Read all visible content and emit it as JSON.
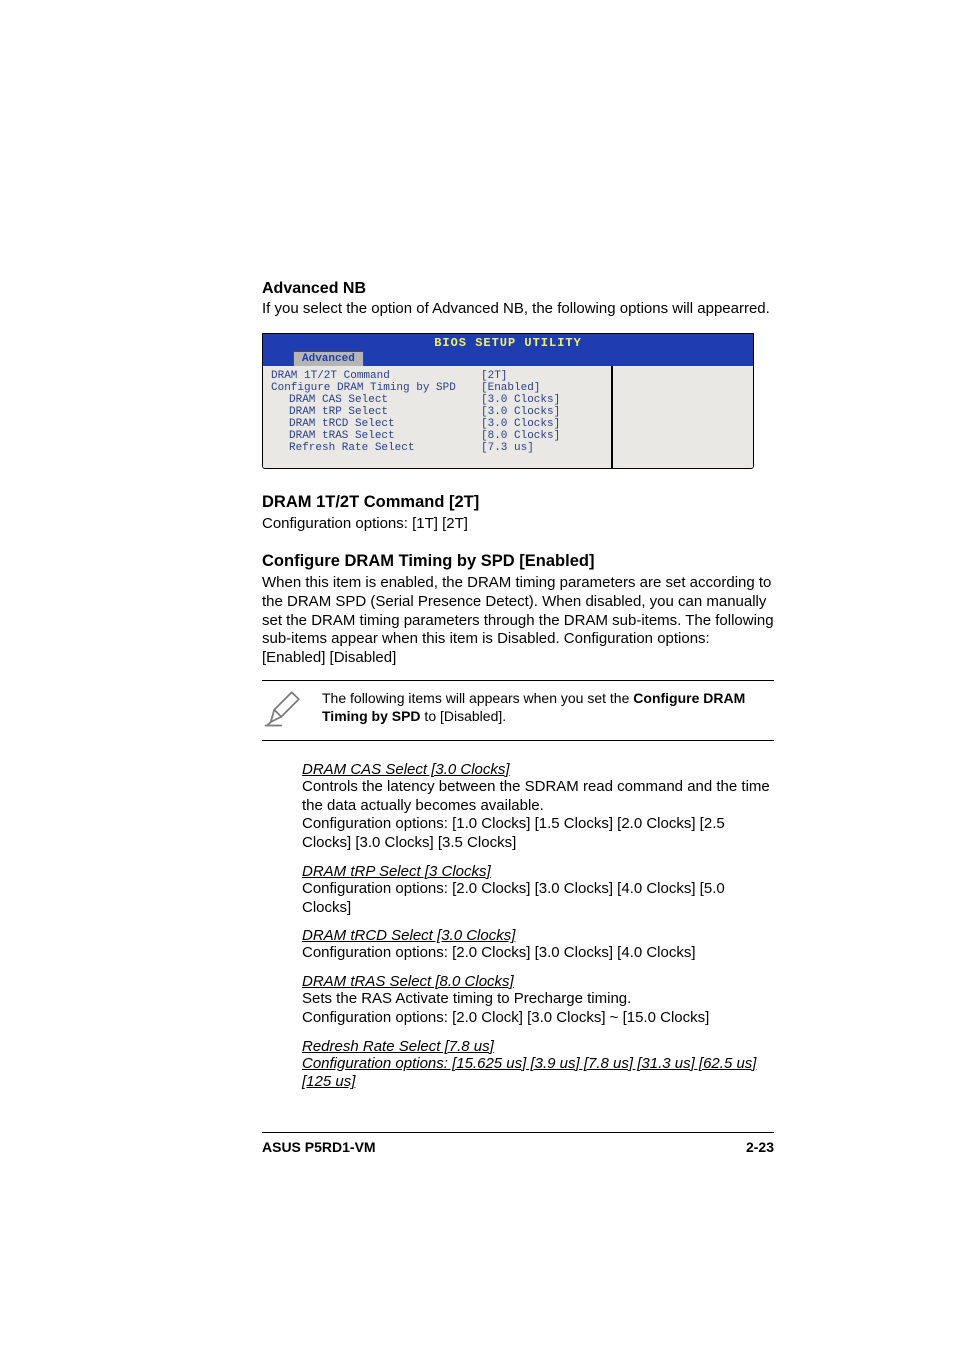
{
  "section_title": "Advanced NB",
  "intro": "If you select the option of Advanced NB, the following options will appearred.",
  "bios": {
    "title": "BIOS SETUP UTILITY",
    "tab": "Advanced",
    "rows": [
      {
        "k": "DRAM 1T/2T Command",
        "v": "[2T]",
        "sub": false
      },
      {
        "k": "Configure DRAM Timing by SPD",
        "v": "[Enabled]",
        "sub": false
      },
      {
        "k": "DRAM CAS Select",
        "v": "[3.0 Clocks]",
        "sub": true
      },
      {
        "k": "DRAM tRP Select",
        "v": "[3.0 Clocks]",
        "sub": true
      },
      {
        "k": "DRAM tRCD Select",
        "v": "[3.0 Clocks]",
        "sub": true
      },
      {
        "k": "DRAM tRAS Select",
        "v": "[8.0 Clocks]",
        "sub": true
      },
      {
        "k": "Refresh Rate Select",
        "v": "[7.3 us]",
        "sub": true
      }
    ]
  },
  "items": [
    {
      "title": "DRAM 1T/2T Command [2T]",
      "body": "Configuration options: [1T] [2T]"
    },
    {
      "title": "Configure DRAM Timing by SPD [Enabled]",
      "body": "When this item is enabled, the DRAM timing parameters are set according to the DRAM SPD (Serial Presence Detect). When disabled, you can manually set the DRAM timing parameters through the DRAM sub-items. The following sub-items appear when this item is Disabled. Configuration options: [Enabled] [Disabled]"
    }
  ],
  "note": {
    "pre": "The following items will appears when you set the ",
    "bold1": "Configure DRAM Timing by SPD",
    "mid": " to [Disabled]."
  },
  "subs": [
    {
      "head": "DRAM CAS Select [3.0 Clocks]",
      "lines": [
        "Controls the latency between the SDRAM read command and the time the data actually becomes available.",
        "Configuration options: [1.0 Clocks] [1.5 Clocks] [2.0 Clocks] [2.5 Clocks] [3.0 Clocks] [3.5 Clocks]"
      ]
    },
    {
      "head": "DRAM tRP Select [3 Clocks]",
      "lines": [
        "Configuration options: [2.0 Clocks] [3.0 Clocks] [4.0 Clocks] [5.0 Clocks]"
      ]
    },
    {
      "head": "DRAM tRCD Select [3.0 Clocks]",
      "lines": [
        "Configuration options: [2.0 Clocks] [3.0 Clocks]  [4.0 Clocks]"
      ]
    },
    {
      "head": "DRAM tRAS Select [8.0 Clocks]",
      "lines": [
        "Sets the RAS Activate timing to Precharge timing.",
        "Configuration options: [2.0 Clock] [3.0 Clocks] ~ [15.0 Clocks]"
      ]
    }
  ],
  "final_underlined": {
    "head": "Redresh Rate Select [7.8 us]",
    "line": "Configuration options: [15.625 us] [3.9 us] [7.8 us] [31.3 us] [62.5 us] [125 us]"
  },
  "footer": {
    "left": "ASUS P5RD1-VM",
    "right": "2-23"
  }
}
